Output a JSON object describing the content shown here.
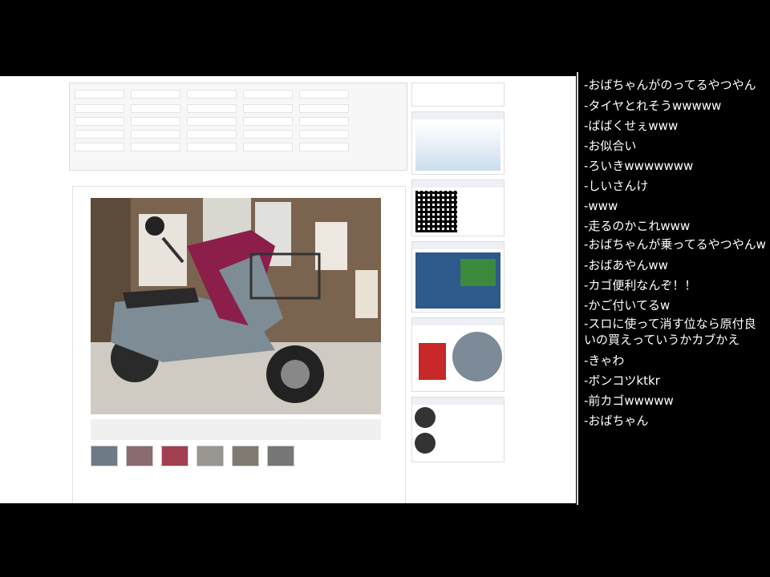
{
  "chat": {
    "comments": [
      "-おばちゃんがのってるやつやん",
      "-タイヤとれそうwwwww",
      "-ばばくせぇwww",
      "-お似合い",
      "-ろいきwwwwwww",
      "-しいさんけ",
      "-www",
      "-走るのかこれwww",
      "-おばちゃんが乗ってるやつやんw",
      "-おばあやんww",
      "-カゴ便利なんぞ！！",
      "-かご付いてるw",
      "-スロに使って消す位なら原付良いの買えっていうかカブかえ",
      "-きゃわ",
      "-ボンコツktkr",
      "-前カゴwwwww",
      "-おばちゃん"
    ]
  },
  "colors": {
    "background": "#000000",
    "chat_text": "#ffffff",
    "page_background": "#ffffff",
    "scooter_body": "#8c1e4a",
    "scooter_grey": "#7d8c95"
  },
  "icons": {
    "qr_code": "qr-code-icon",
    "user_avatar": "avatar-icon",
    "helmet_ad": "helmet-icon"
  }
}
